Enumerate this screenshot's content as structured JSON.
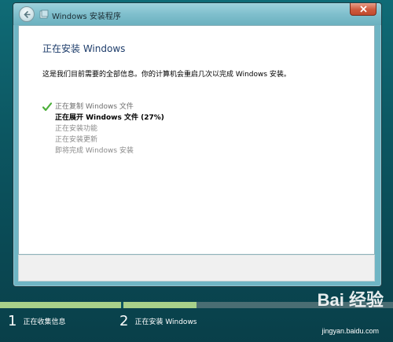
{
  "window": {
    "title": "Windows 安装程序",
    "heading": "正在安装 Windows",
    "info_text": "这是我们目前需要的全部信息。你的计算机会重启几次以完成 Windows 安装。"
  },
  "steps": [
    {
      "label": "正在复制 Windows 文件",
      "state": "done"
    },
    {
      "label": "正在展开 Windows 文件 (27%)",
      "state": "current"
    },
    {
      "label": "正在安装功能",
      "state": "pending"
    },
    {
      "label": "正在安装更新",
      "state": "pending"
    },
    {
      "label": "即将完成 Windows 安装",
      "state": "pending"
    }
  ],
  "progress": {
    "stage1_fraction": 1.0,
    "stage2_fraction": 0.27
  },
  "stages": [
    {
      "number": "1",
      "label": "正在收集信息"
    },
    {
      "number": "2",
      "label": "正在安装 Windows"
    }
  ],
  "watermark": {
    "brand": "Bai 经验",
    "url": "jingyan.baidu.com"
  },
  "colors": {
    "accent_green": "#a8d08a",
    "heading_blue": "#1e3d6b",
    "check_green": "#4caf3a"
  }
}
